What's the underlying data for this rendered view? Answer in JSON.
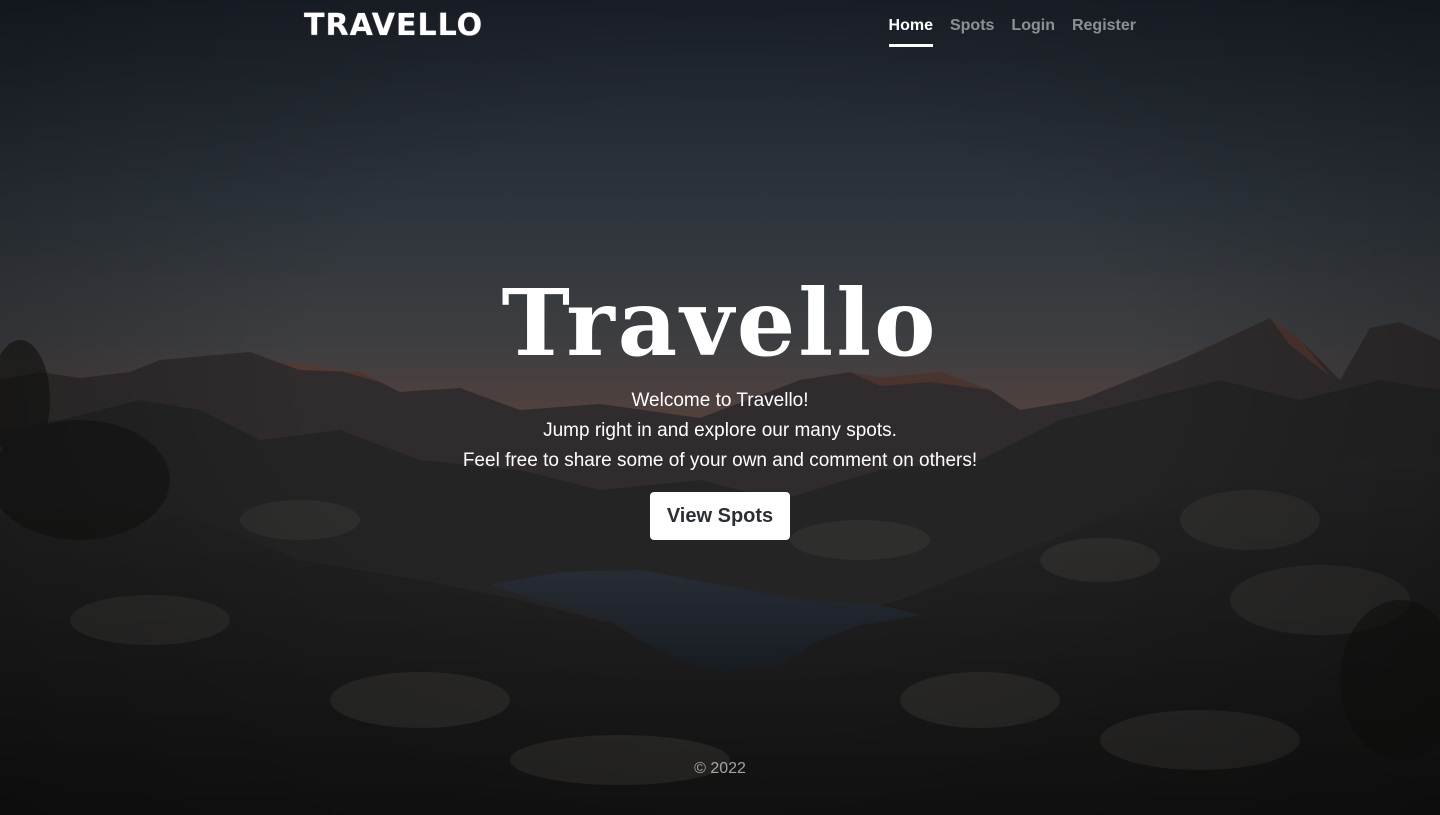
{
  "brand": {
    "name": "TRAVELLO"
  },
  "nav": {
    "items": [
      {
        "label": "Home",
        "active": true
      },
      {
        "label": "Spots",
        "active": false
      },
      {
        "label": "Login",
        "active": false
      },
      {
        "label": "Register",
        "active": false
      }
    ]
  },
  "hero": {
    "title": "Travello",
    "lines": [
      "Welcome to Travello!",
      "Jump right in and explore our many spots.",
      "Feel free to share some of your own and comment on others!"
    ],
    "cta_label": "View Spots"
  },
  "footer": {
    "copyright": "© 2022"
  },
  "background": {
    "subject": "mountain-lake-dusk-photo",
    "sky_top": "#2d3745",
    "sky_bottom": "#6b5a58",
    "horizon_glow": "#a86a50",
    "rock_color": "#3e3c39"
  }
}
